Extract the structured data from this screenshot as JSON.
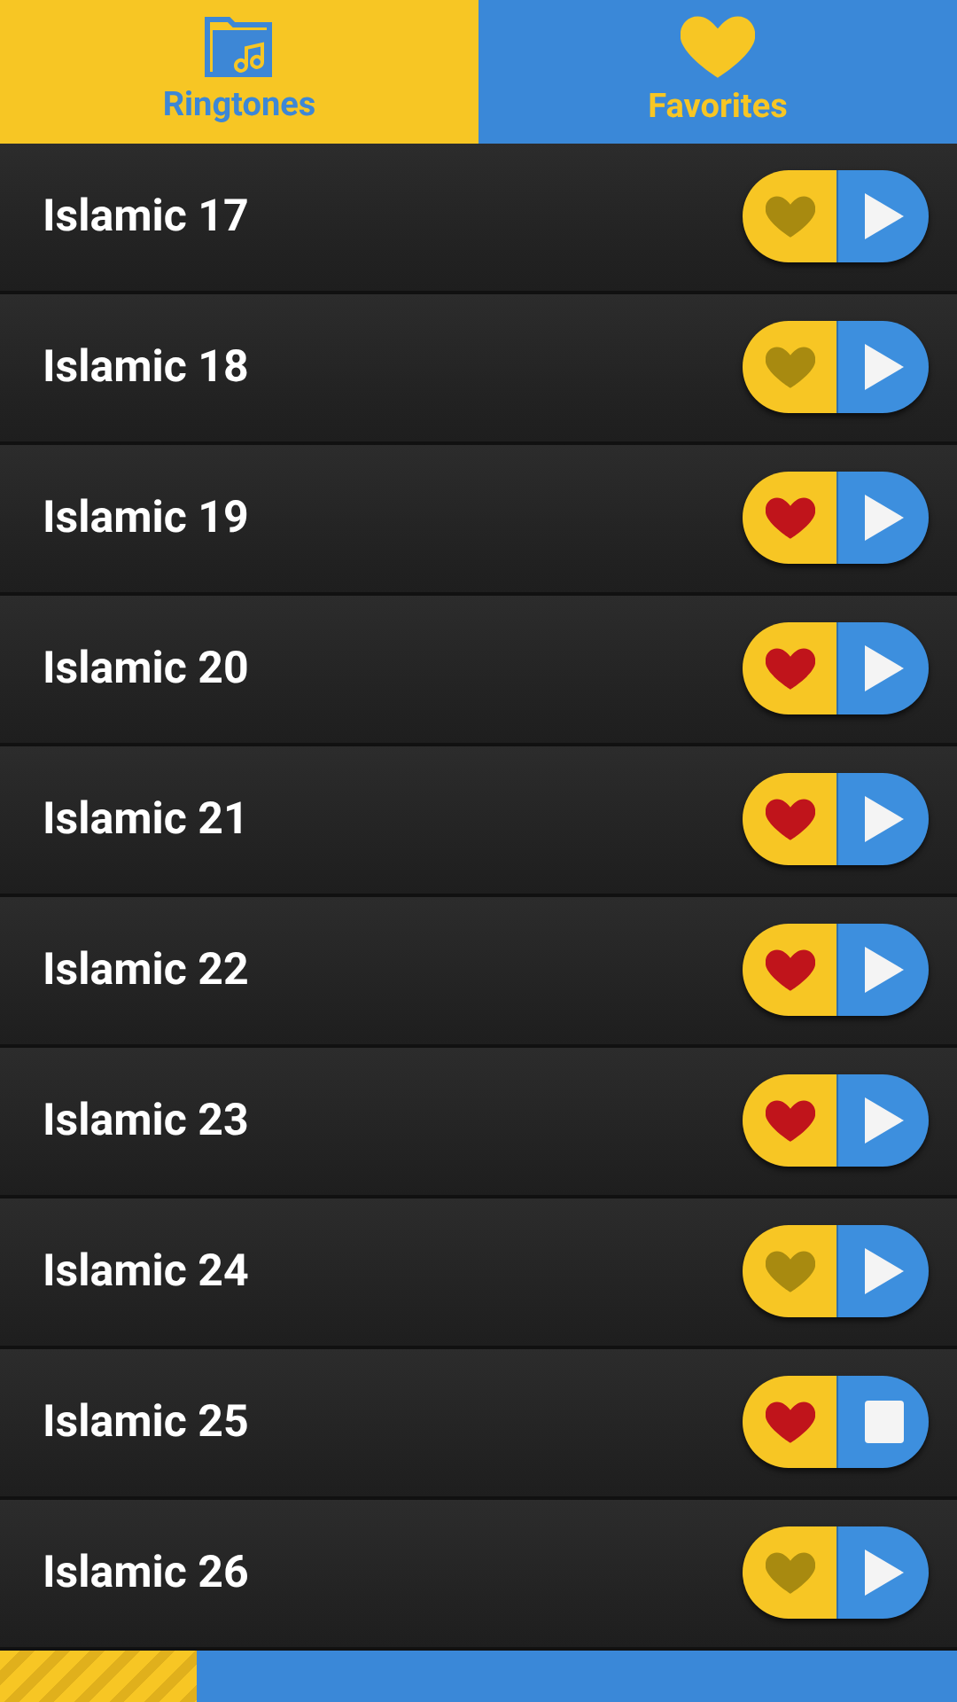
{
  "tabs": [
    {
      "label": "Ringtones",
      "kind": "folder",
      "selected": true
    },
    {
      "label": "Favorites",
      "kind": "heart",
      "selected": false
    }
  ],
  "rows": [
    {
      "title": "Islamic 17",
      "favorite": false,
      "playing": false
    },
    {
      "title": "Islamic 18",
      "favorite": false,
      "playing": false
    },
    {
      "title": "Islamic 19",
      "favorite": true,
      "playing": false
    },
    {
      "title": "Islamic 20",
      "favorite": true,
      "playing": false
    },
    {
      "title": "Islamic 21",
      "favorite": true,
      "playing": false
    },
    {
      "title": "Islamic 22",
      "favorite": true,
      "playing": false
    },
    {
      "title": "Islamic 23",
      "favorite": true,
      "playing": false
    },
    {
      "title": "Islamic 24",
      "favorite": false,
      "playing": false
    },
    {
      "title": "Islamic 25",
      "favorite": true,
      "playing": true
    },
    {
      "title": "Islamic 26",
      "favorite": false,
      "playing": false
    }
  ],
  "progress": {
    "level": 0.205
  }
}
